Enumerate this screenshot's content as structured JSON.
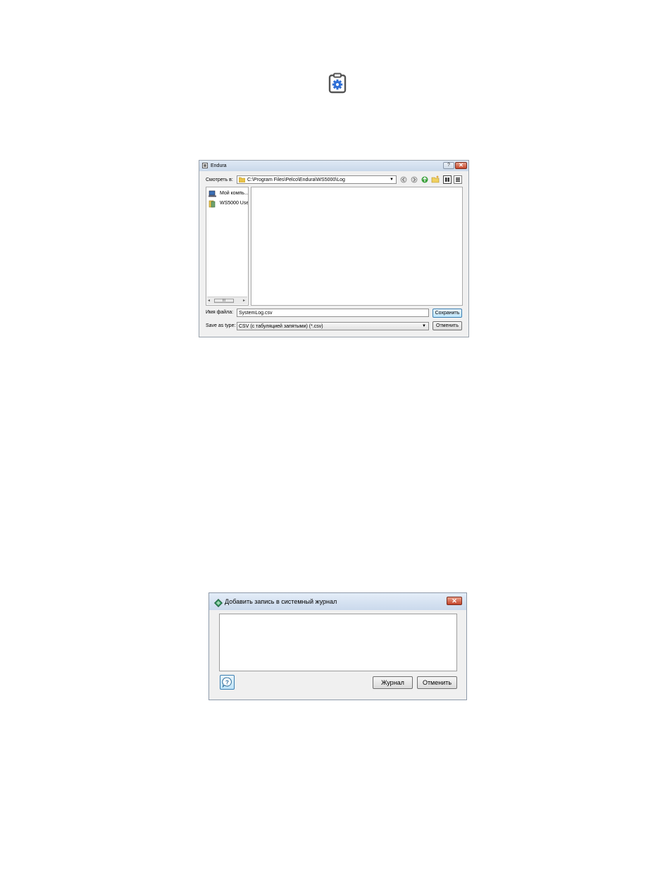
{
  "top_icon": "clipboard-gear-icon",
  "save_dialog": {
    "title": "Endura",
    "help_glyph": "?",
    "close_glyph": "✕",
    "look_in_label": "Смотреть в:",
    "look_in_path": "C:\\Program Files\\Pelco\\Endura\\WS5000\\Log",
    "nav_items": [
      {
        "label": "Мой компь...",
        "icon": "computer-icon"
      },
      {
        "label": "WS5000 Use",
        "icon": "user-folder-icon"
      }
    ],
    "scroll_thumb": "III",
    "file_name_label": "Имя файла:",
    "file_name_value": "SystemLog.csv",
    "save_button": "Сохранить",
    "save_as_type_label": "Save as type:",
    "save_as_type_value": "CSV (с табуляцией запятыми) (*.csv)",
    "cancel_button": "Отменить"
  },
  "log_dialog": {
    "title": "Добавить запись в системный журнал",
    "close_glyph": "✕",
    "journal_button": "Журнал",
    "cancel_button": "Отменить",
    "textarea_value": ""
  }
}
